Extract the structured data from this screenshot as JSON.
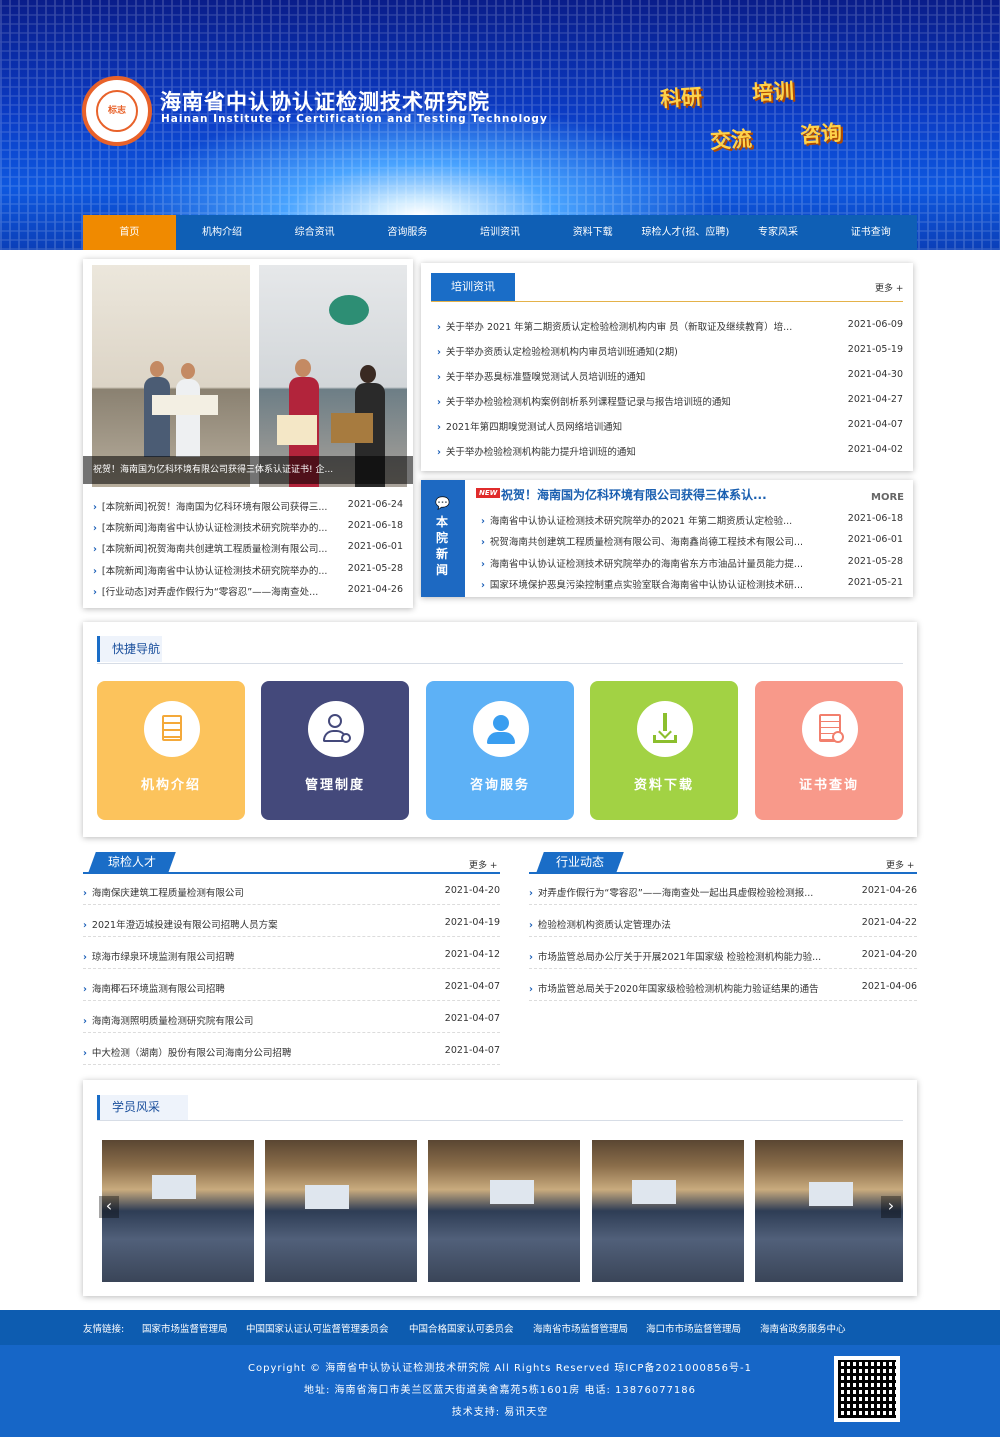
{
  "header": {
    "logo_text": "标志",
    "title": "海南省中认协认证检测技术研究院",
    "subtitle": "Hainan Institute of Certification and Testing Technology",
    "slogans": [
      "科研",
      "培训",
      "交流",
      "咨询"
    ]
  },
  "nav": [
    "首页",
    "机构介绍",
    "综合资讯",
    "咨询服务",
    "培训资讯",
    "资料下载",
    "琼检人才(招、应聘)",
    "专家风采",
    "证书查询"
  ],
  "carousel": {
    "caption": "祝贺！海南国为亿科环境有限公司获得三体系认证证书! 企..."
  },
  "news_left": [
    {
      "title": "[本院新闻]祝贺！海南国为亿科环境有限公司获得三...",
      "date": "2021-06-24"
    },
    {
      "title": "[本院新闻]海南省中认协认证检测技术研究院举办的...",
      "date": "2021-06-18"
    },
    {
      "title": "[本院新闻]祝贺海南共创建筑工程质量检测有限公司...",
      "date": "2021-06-01"
    },
    {
      "title": "[本院新闻]海南省中认协认证检测技术研究院举办的...",
      "date": "2021-05-28"
    },
    {
      "title": "[行业动态]对弄虚作假行为“零容忍”——海南查处...",
      "date": "2021-04-26"
    }
  ],
  "training": {
    "tab": "培训资讯",
    "more": "更多",
    "items": [
      {
        "title": "关于举办 2021 年第二期资质认定检验检测机构内审 员（新取证及继续教育）培...",
        "date": "2021-06-09"
      },
      {
        "title": "关于举办资质认定检验检测机构内审员培训班通知(2期)",
        "date": "2021-05-19"
      },
      {
        "title": "关于举办恶臭标准暨嗅觉测试人员培训班的通知",
        "date": "2021-04-30"
      },
      {
        "title": "关于举办检验检测机构案例剖析系列课程暨记录与报告培训班的通知",
        "date": "2021-04-27"
      },
      {
        "title": "2021年第四期嗅觉测试人员网络培训通知",
        "date": "2021-04-07"
      },
      {
        "title": "关于举办检验检测机构能力提升培训班的通知",
        "date": "2021-04-02"
      }
    ]
  },
  "institute_news": {
    "side_label": "本院新闻",
    "new_badge": "NEW",
    "headline": "祝贺！海南国为亿科环境有限公司获得三体系认...",
    "more": "MORE",
    "items": [
      {
        "title": "海南省中认协认证检测技术研究院举办的2021 年第二期资质认定检验...",
        "date": "2021-06-18"
      },
      {
        "title": "祝贺海南共创建筑工程质量检测有限公司、海南鑫尚德工程技术有限公司...",
        "date": "2021-06-01"
      },
      {
        "title": "海南省中认协认证检测技术研究院举办的海南省东方市油品计量员能力提...",
        "date": "2021-05-28"
      },
      {
        "title": "国家环境保护恶臭污染控制重点实验室联合海南省中认协认证检测技术研...",
        "date": "2021-05-21"
      }
    ]
  },
  "quick_nav": {
    "title": "快捷导航",
    "cards": [
      {
        "label": "机构介绍",
        "icon": "document-icon",
        "color": "#fcc35c"
      },
      {
        "label": "管理制度",
        "icon": "user-settings-icon",
        "color": "#44497b"
      },
      {
        "label": "咨询服务",
        "icon": "headset-user-icon",
        "color": "#5db1f6"
      },
      {
        "label": "资料下载",
        "icon": "download-icon",
        "color": "#a2d244"
      },
      {
        "label": "证书查询",
        "icon": "certificate-icon",
        "color": "#f8998a"
      }
    ]
  },
  "talent": {
    "title": "琼检人才",
    "more": "更多",
    "items": [
      {
        "title": "海南保庆建筑工程质量检测有限公司",
        "date": "2021-04-20"
      },
      {
        "title": "2021年澄迈城投建设有限公司招聘人员方案",
        "date": "2021-04-19"
      },
      {
        "title": "琼海市绿泉环境监测有限公司招聘",
        "date": "2021-04-12"
      },
      {
        "title": "海南椰石环境监测有限公司招聘",
        "date": "2021-04-07"
      },
      {
        "title": "海南海测照明质量检测研究院有限公司",
        "date": "2021-04-07"
      },
      {
        "title": "中大检测（湖南）股份有限公司海南分公司招聘",
        "date": "2021-04-07"
      }
    ]
  },
  "industry": {
    "title": "行业动态",
    "more": "更多",
    "items": [
      {
        "title": "对弄虚作假行为“零容忍”——海南查处一起出具虚假检验检测报...",
        "date": "2021-04-26"
      },
      {
        "title": "检验检测机构资质认定管理办法",
        "date": "2021-04-22"
      },
      {
        "title": "市场监管总局办公厅关于开展2021年国家级 检验检测机构能力验...",
        "date": "2021-04-20"
      },
      {
        "title": "市场监管总局关于2020年国家级检验检测机构能力验证结果的通告",
        "date": "2021-04-06"
      }
    ]
  },
  "students": {
    "title": "学员风采",
    "prev": "‹",
    "next": "›"
  },
  "friend_links": {
    "label": "友情链接:",
    "items": [
      "国家市场监督管理局",
      "中国国家认证认可监督管理委员会",
      "中国合格国家认可委员会",
      "海南省市场监督管理局",
      "海口市市场监督管理局",
      "海南省政务服务中心"
    ]
  },
  "footer": {
    "copyright": "Copyright © 海南省中认协认证检测技术研究院 All Rights Reserved 琼ICP备2021000856号-1",
    "address": "地址: 海南省海口市美兰区蓝天街道美舍嘉苑5栋1601房 电话: 13876077186",
    "support": "技术支持: 易讯天空"
  }
}
